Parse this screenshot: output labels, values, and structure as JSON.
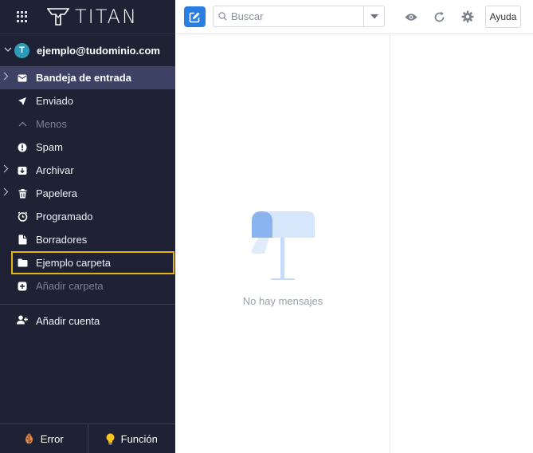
{
  "app": {
    "logo_text": "TITAN"
  },
  "account": {
    "avatar_initial": "T",
    "email": "ejemplo@tudominio.com"
  },
  "folders": [
    {
      "label": "Bandeja de entrada",
      "icon": "envelope-icon"
    },
    {
      "label": "Enviado",
      "icon": "send-icon"
    },
    {
      "label": "Menos",
      "icon": "chevron-up-icon"
    },
    {
      "label": "Spam",
      "icon": "alert-icon"
    },
    {
      "label": "Archivar",
      "icon": "archive-icon"
    },
    {
      "label": "Papelera",
      "icon": "trash-icon"
    },
    {
      "label": "Programado",
      "icon": "clock-icon"
    },
    {
      "label": "Borradores",
      "icon": "draft-icon"
    },
    {
      "label": "Ejemplo carpeta",
      "icon": "folder-icon"
    },
    {
      "label": "Añadir carpeta",
      "icon": "plus-icon"
    }
  ],
  "add_account_label": "Añadir cuenta",
  "footer": {
    "error_label": "Error",
    "feature_label": "Función"
  },
  "search": {
    "placeholder": "Buscar"
  },
  "toolbar": {
    "help_label": "Ayuda"
  },
  "list": {
    "empty_text": "No hay mensajes"
  },
  "colors": {
    "sidebar_bg": "#1f2235",
    "active_bg": "#3d4164",
    "accent": "#2a7de1",
    "highlight_border": "#e7b416"
  }
}
